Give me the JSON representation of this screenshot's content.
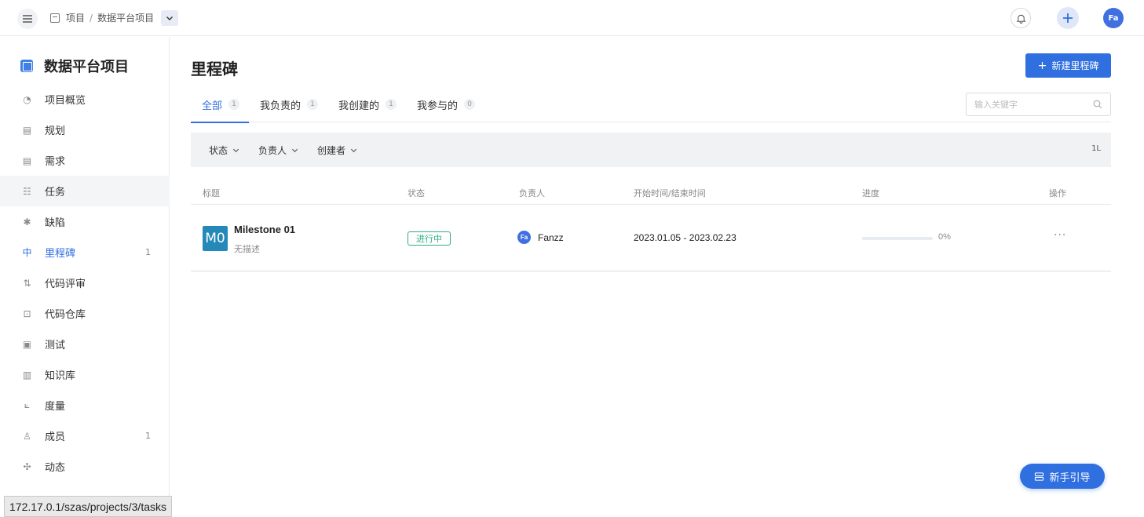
{
  "breadcrumb": {
    "root": "项目",
    "separator": "/",
    "current": "数据平台项目"
  },
  "user": {
    "avatar": "Fa"
  },
  "sidebar": {
    "project_name": "数据平台项目",
    "items": [
      {
        "label": "项目概览",
        "icon": "dashboard-icon",
        "count": ""
      },
      {
        "label": "规划",
        "icon": "calendar-icon",
        "count": ""
      },
      {
        "label": "需求",
        "icon": "requirement-icon",
        "count": ""
      },
      {
        "label": "任务",
        "icon": "task-icon",
        "count": ""
      },
      {
        "label": "缺陷",
        "icon": "bug-icon",
        "count": ""
      },
      {
        "label": "里程碑",
        "icon": "milestone-icon",
        "count": "1"
      },
      {
        "label": "代码评审",
        "icon": "merge-icon",
        "count": ""
      },
      {
        "label": "代码仓库",
        "icon": "code-icon",
        "count": ""
      },
      {
        "label": "测试",
        "icon": "test-icon",
        "count": ""
      },
      {
        "label": "知识库",
        "icon": "book-icon",
        "count": ""
      },
      {
        "label": "度量",
        "icon": "chart-icon",
        "count": ""
      },
      {
        "label": "成员",
        "icon": "members-icon",
        "count": "1"
      },
      {
        "label": "动态",
        "icon": "activity-icon",
        "count": ""
      }
    ]
  },
  "main": {
    "title": "里程碑",
    "new_button": "新建里程碑",
    "tabs": [
      {
        "label": "全部",
        "count": "1"
      },
      {
        "label": "我负责的",
        "count": "1"
      },
      {
        "label": "我创建的",
        "count": "1"
      },
      {
        "label": "我参与的",
        "count": "0"
      }
    ],
    "search_placeholder": "输入关键字",
    "filters": [
      {
        "label": "状态"
      },
      {
        "label": "负责人"
      },
      {
        "label": "创建者"
      }
    ],
    "sort_icon": "1L",
    "columns": {
      "title": "标题",
      "status": "状态",
      "owner": "负责人",
      "dates": "开始时间/结束时间",
      "progress": "进度",
      "actions": "操作"
    },
    "rows": [
      {
        "icon_text": "M0",
        "title": "Milestone 01",
        "description": "无描述",
        "status": "进行中",
        "owner_avatar": "Fa",
        "owner": "Fanzz",
        "dates": "2023.01.05  -  2023.02.23",
        "progress": 0,
        "progress_label": "0%",
        "more": "···"
      }
    ]
  },
  "guide_button": "新手引导",
  "status_url": "172.17.0.1/szas/projects/3/tasks",
  "colors": {
    "accent": "#2f6fe0",
    "status_green": "#2fae7f",
    "milestone_icon_bg": "#2489b8"
  }
}
